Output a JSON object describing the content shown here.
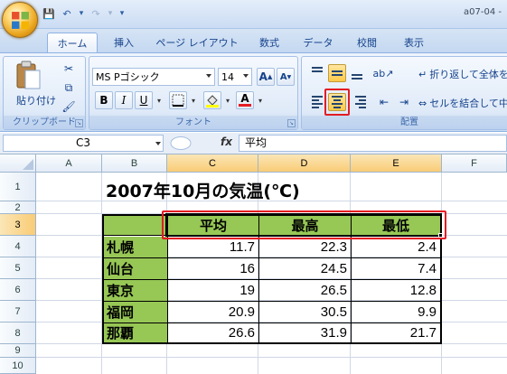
{
  "window": {
    "doc_title": "a07-04 -"
  },
  "qat": {
    "save_icon": "💾",
    "undo_icon": "↶",
    "undo_drop": "▾",
    "redo_icon": "↷",
    "redo_drop": "▾",
    "more": "▾"
  },
  "tabs": [
    "ホーム",
    "挿入",
    "ページ レイアウト",
    "数式",
    "データ",
    "校閲",
    "表示"
  ],
  "ribbon": {
    "clipboard": {
      "paste_label": "貼り付け",
      "group_label": "クリップボード"
    },
    "font": {
      "font_name": "MS Pゴシック",
      "font_size": "14",
      "grow": "A",
      "shrink": "A",
      "bold": "B",
      "italic": "I",
      "underline": "U",
      "font_color_glyph": "A",
      "group_label": "フォント"
    },
    "alignment": {
      "wrap_text": "折り返して全体を",
      "merge_center": "セルを結合して中",
      "group_label": "配置"
    }
  },
  "formula_bar": {
    "name_box": "C3",
    "fx": "fx",
    "formula": "平均"
  },
  "grid": {
    "columns": [
      "A",
      "B",
      "C",
      "D",
      "E",
      "F"
    ],
    "rows": [
      "1",
      "2",
      "3",
      "4",
      "5",
      "6",
      "7",
      "8",
      "9",
      "10"
    ],
    "title": "2007年10月の気温(℃)",
    "headers": [
      "平均",
      "最高",
      "最低"
    ],
    "data": [
      {
        "city": "札幌",
        "avg": "11.7",
        "max": "22.3",
        "min": "2.4"
      },
      {
        "city": "仙台",
        "avg": "16",
        "max": "24.5",
        "min": "7.4"
      },
      {
        "city": "東京",
        "avg": "19",
        "max": "26.5",
        "min": "12.8"
      },
      {
        "city": "福岡",
        "avg": "20.9",
        "max": "30.5",
        "min": "9.9"
      },
      {
        "city": "那覇",
        "avg": "26.6",
        "max": "31.9",
        "min": "21.7"
      }
    ]
  },
  "colors": {
    "header_fill": "#97c755",
    "highlight": "#e41c23",
    "selected_header": "#f9cc76"
  }
}
